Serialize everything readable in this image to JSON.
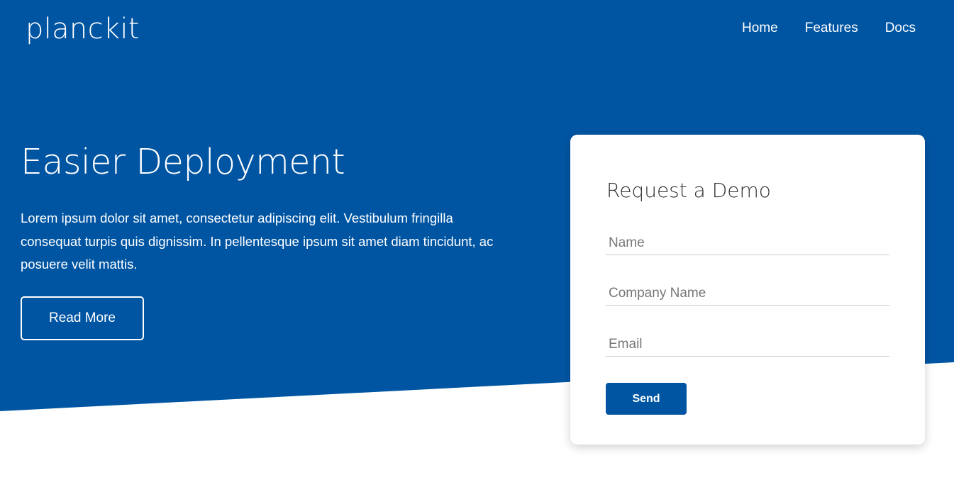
{
  "colors": {
    "hero_background": "#0055a2",
    "button_primary": "#0055a2",
    "text_light": "#ffffff",
    "card_background": "#ffffff"
  },
  "header": {
    "brand": "planckit",
    "nav": [
      {
        "label": "Home"
      },
      {
        "label": "Features"
      },
      {
        "label": "Docs"
      }
    ]
  },
  "hero": {
    "title": "Easier Deployment",
    "text": "Lorem ipsum dolor sit amet, consectetur adipiscing elit. Vestibulum fringilla consequat turpis quis dignissim. In pellentesque ipsum sit amet diam tincidunt, ac posuere velit mattis.",
    "button_label": "Read More"
  },
  "demo_form": {
    "title": "Request a Demo",
    "fields": {
      "name_placeholder": "Name",
      "company_placeholder": "Company Name",
      "email_placeholder": "Email"
    },
    "send_label": "Send"
  }
}
